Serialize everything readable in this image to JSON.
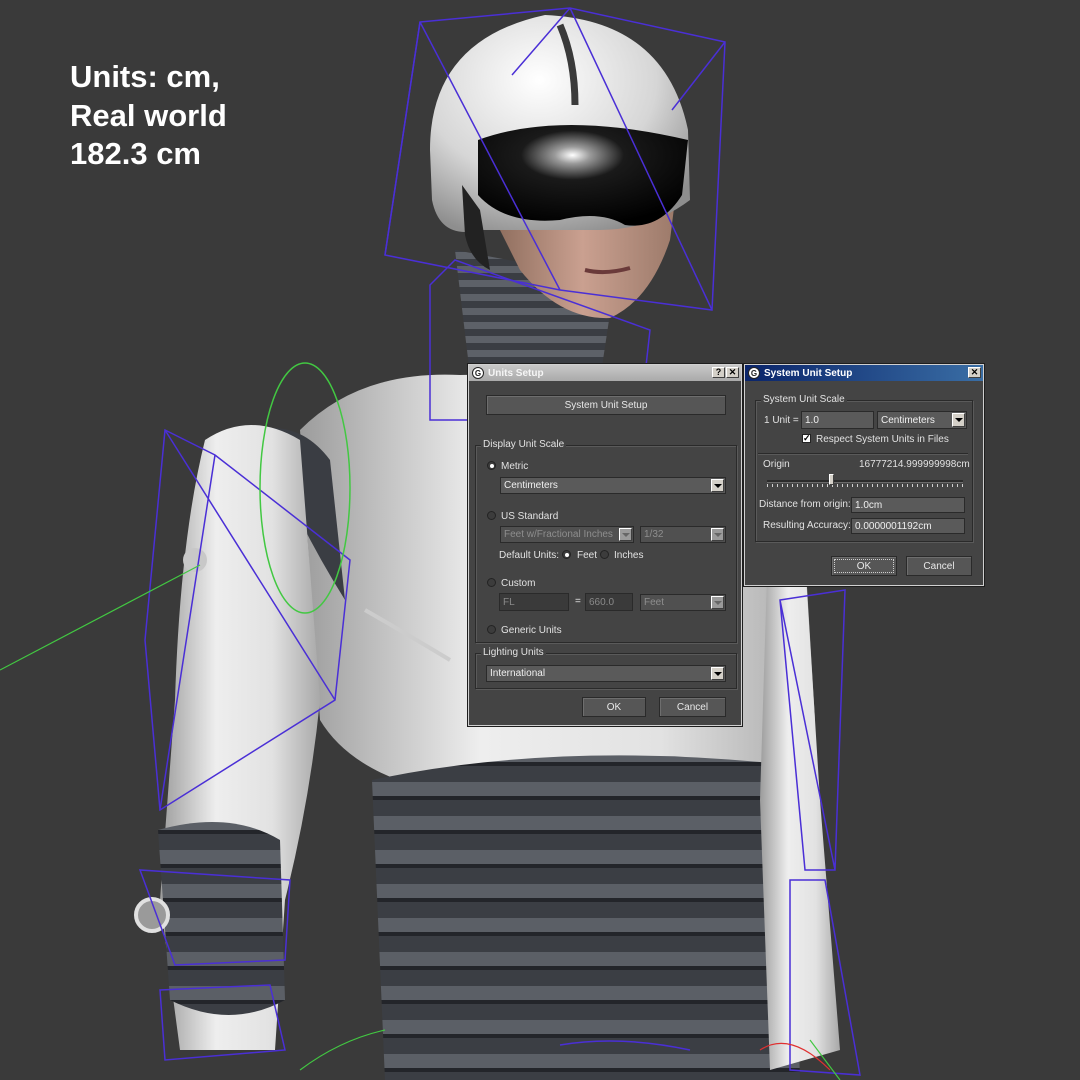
{
  "overlay": {
    "line1": "Units: cm,",
    "line2": "Real world",
    "line3": "182.3 cm"
  },
  "units_setup": {
    "title": "Units Setup",
    "help_btn": "?",
    "close_btn": "✕",
    "system_unit_setup_button": "System Unit Setup",
    "display_unit_scale": {
      "label": "Display Unit Scale",
      "metric_label": "Metric",
      "metric_value": "Centimeters",
      "us_standard_label": "US Standard",
      "us_standard_value": "Feet w/Fractional Inches",
      "fraction_value": "1/32",
      "default_units_label": "Default Units:",
      "feet_label": "Feet",
      "inches_label": "Inches",
      "custom_label": "Custom",
      "custom_name": "FL",
      "custom_equals": "=",
      "custom_value": "660.0",
      "custom_unit": "Feet",
      "generic_label": "Generic Units",
      "selected": "Metric"
    },
    "lighting_units": {
      "label": "Lighting Units",
      "value": "International"
    },
    "ok": "OK",
    "cancel": "Cancel"
  },
  "system_unit_setup": {
    "title": "System Unit Setup",
    "close_btn": "✕",
    "scale_group": "System Unit Scale",
    "unit_label": "1 Unit =",
    "unit_value": "1.0",
    "unit_type": "Centimeters",
    "respect_label": "Respect System Units in Files",
    "respect_checked": true,
    "origin_label": "Origin",
    "origin_value": "16777214.999999998cm",
    "distance_label": "Distance from origin:",
    "distance_value": "1.0cm",
    "accuracy_label": "Resulting Accuracy:",
    "accuracy_value": "0.0000001192cm",
    "ok": "OK",
    "cancel": "Cancel"
  },
  "colors": {
    "background": "#3a3a3a",
    "dialog_bg": "#444444",
    "active_title": "#0a246a",
    "bone_wire": "#4a2fd6"
  }
}
